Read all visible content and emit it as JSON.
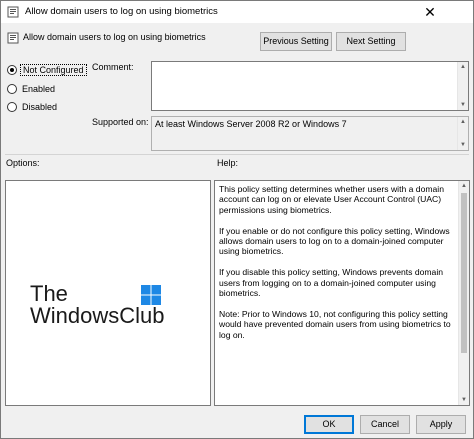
{
  "window": {
    "title": "Allow domain users to log on using biometrics",
    "close_glyph": "✕"
  },
  "header": {
    "title": "Allow domain users to log on using biometrics",
    "prev_button": "Previous Setting",
    "next_button": "Next Setting"
  },
  "state": {
    "options": [
      {
        "label": "Not Configured",
        "checked": true
      },
      {
        "label": "Enabled",
        "checked": false
      },
      {
        "label": "Disabled",
        "checked": false
      }
    ]
  },
  "comment": {
    "label": "Comment:",
    "value": ""
  },
  "supported_on": {
    "label": "Supported on:",
    "value": "At least Windows Server 2008 R2 or Windows 7"
  },
  "options_pane": {
    "label": "Options:",
    "logo_line1": "The",
    "logo_line2": "WindowsClub"
  },
  "help_pane": {
    "label": "Help:",
    "paragraphs": [
      "This policy setting determines whether users with a domain account can log on or elevate User Account Control (UAC) permissions using biometrics.",
      "If you enable or do not configure this policy setting, Windows allows domain users to log on to a domain-joined computer using biometrics.",
      "If you disable this policy setting, Windows prevents domain users from logging on to a domain-joined computer using biometrics.",
      "Note: Prior to Windows 10, not configuring this policy setting would have prevented domain users from using biometrics to log on."
    ]
  },
  "footer": {
    "ok": "OK",
    "cancel": "Cancel",
    "apply": "Apply"
  },
  "colors": {
    "window_bg": "#f0f0f0",
    "accent": "#0078d7",
    "logo_blue": "#1e88e5"
  },
  "icons": [
    "policy-icon",
    "close-icon",
    "radio-icon",
    "scroll-up-icon",
    "scroll-down-icon",
    "windows-logo-icon"
  ]
}
